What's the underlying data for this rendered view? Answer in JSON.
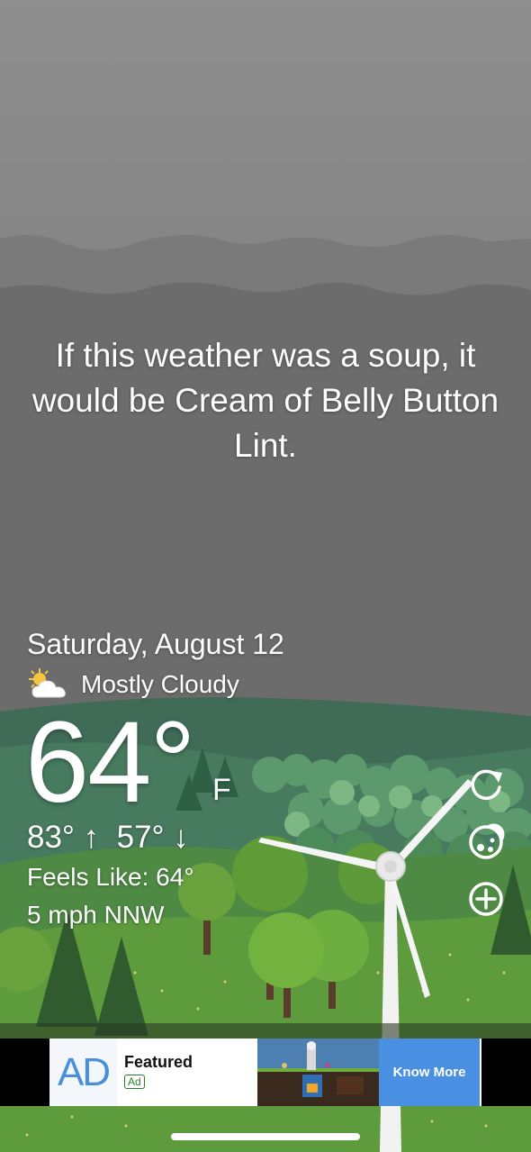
{
  "quote": "If this weather was a soup, it would be Cream of Belly Button Lint.",
  "date": "Saturday, August 12",
  "condition": {
    "text": "Mostly Cloudy",
    "icon": "partly-cloudy-icon"
  },
  "temperature": {
    "value": "64°",
    "unit": "F"
  },
  "high_low": "83° ↑  57° ↓",
  "feels_like": "Feels Like: 64°",
  "wind": "5 mph NNW",
  "side_buttons": [
    {
      "icon": "refresh-icon"
    },
    {
      "icon": "theme-icon"
    },
    {
      "icon": "add-location-icon"
    }
  ],
  "ad": {
    "logo": "AD",
    "title": "Featured",
    "badge": "Ad",
    "cta": "Know More"
  },
  "colors": {
    "sky_top": "#8e8e8e",
    "sky_bottom": "#646464",
    "hill_far": "#3e6a57",
    "grass": "#5d9b3c",
    "cta": "#4a90e2"
  }
}
